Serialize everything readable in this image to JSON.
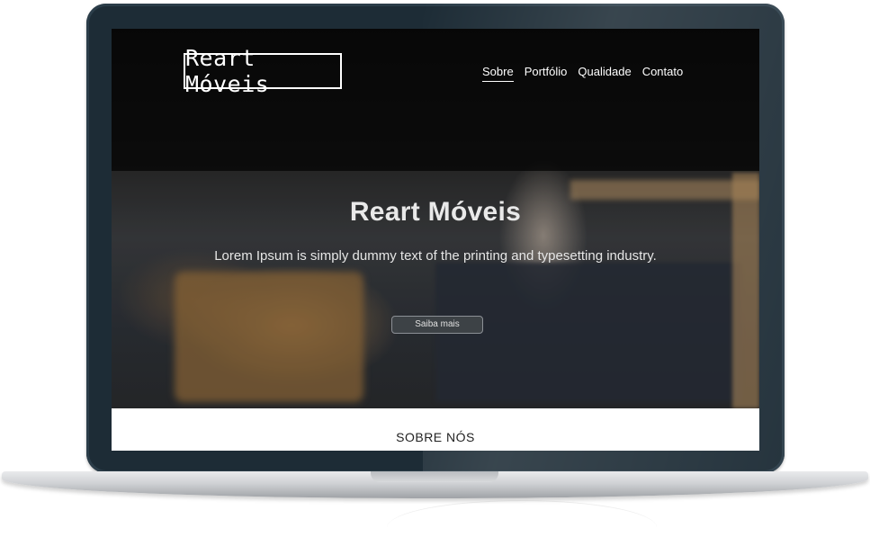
{
  "site": {
    "logo": "Reart Móveis",
    "nav": [
      {
        "label": "Sobre",
        "active": true
      },
      {
        "label": "Portfólio",
        "active": false
      },
      {
        "label": "Qualidade",
        "active": false
      },
      {
        "label": "Contato",
        "active": false
      }
    ],
    "hero": {
      "title": "Reart Móveis",
      "subtitle": "Lorem Ipsum is simply dummy text of the printing and typesetting industry.",
      "button_label": "Saiba mais"
    },
    "about": {
      "title": "SOBRE NÓS"
    }
  },
  "colors": {
    "laptop_frame": "#1d2c36",
    "hero_text": "#e9e9e9",
    "button_bg": "#3d4246"
  }
}
